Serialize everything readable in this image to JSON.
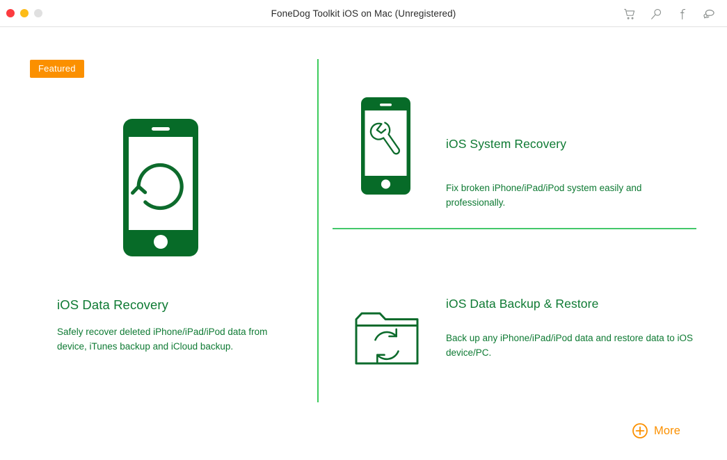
{
  "window": {
    "title": "FoneDog Toolkit iOS on Mac (Unregistered)",
    "traffic_lights": [
      {
        "name": "close",
        "color": "#fc3b3f"
      },
      {
        "name": "minimize",
        "color": "#fdbc18"
      },
      {
        "name": "zoom",
        "color": "#e0e0e0"
      }
    ],
    "actions": [
      {
        "name": "cart-icon",
        "label": "Cart"
      },
      {
        "name": "search-icon",
        "label": "Search"
      },
      {
        "name": "facebook-icon",
        "label": "Facebook"
      },
      {
        "name": "chat-icon",
        "label": "Chat"
      }
    ]
  },
  "badge": {
    "featured_label": "Featured"
  },
  "colors": {
    "brand_green": "#0e7a33",
    "icon_green": "#076b28",
    "divider_green": "#3ecb5d",
    "accent_orange": "#fb9000",
    "title_text": "#2b2b2b"
  },
  "features": {
    "hero": {
      "title": "iOS Data Recovery",
      "description": "Safely recover deleted iPhone/iPad/iPod data from device, iTunes backup and iCloud backup.",
      "icon": "phone-restore-icon"
    },
    "system_recovery": {
      "title": "iOS System Recovery",
      "description": "Fix broken iPhone/iPad/iPod system easily and professionally.",
      "icon": "phone-wrench-icon"
    },
    "backup_restore": {
      "title": "iOS Data Backup & Restore",
      "description": "Back up any iPhone/iPad/iPod data and restore data to iOS device/PC.",
      "icon": "folder-sync-icon"
    }
  },
  "footer": {
    "more_label": "More",
    "more_icon": "plus-circle-icon"
  }
}
